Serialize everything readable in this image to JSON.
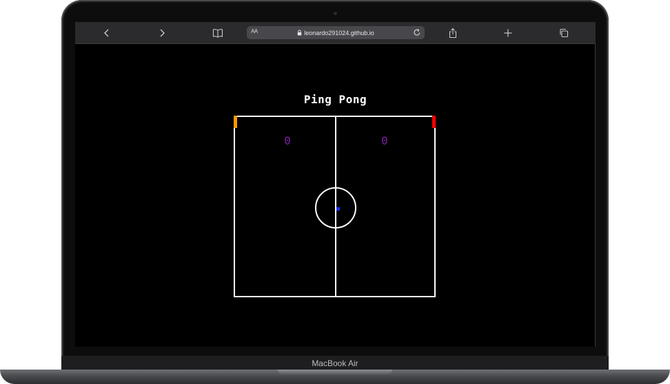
{
  "device": {
    "model_label": "MacBook Air"
  },
  "browser": {
    "url": "leonardo291024.github.io",
    "text_size_label": "AA",
    "icons": {
      "back": "chevron-left-icon",
      "forward": "chevron-right-icon",
      "bookmarks": "book-icon",
      "lock": "lock-icon",
      "reload": "reload-icon",
      "share": "share-icon",
      "new_tab": "plus-icon",
      "tabs": "tabs-icon"
    }
  },
  "page": {
    "title": "Ping Pong",
    "game": {
      "score_left": "0",
      "score_right": "0",
      "colors": {
        "court_lines": "#ffffff",
        "ball": "#1a2cff",
        "score": "#7a1fa2",
        "paddle_left": "#ff9900",
        "paddle_right": "#ff0000"
      }
    }
  }
}
